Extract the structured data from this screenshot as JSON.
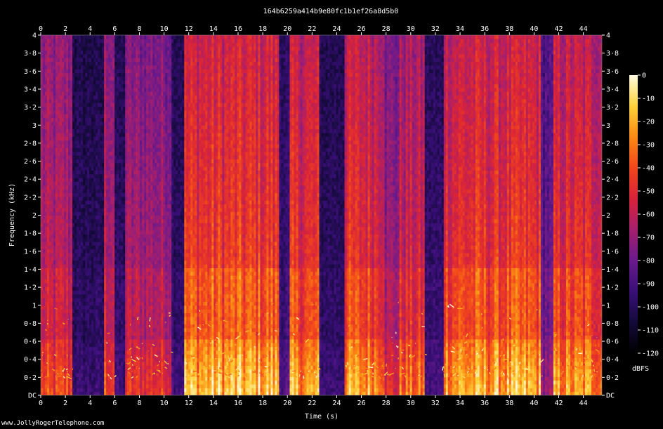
{
  "chart_data": {
    "type": "heatmap",
    "title": "164b6259a414b9e80fc1b1ef26a8d5b0",
    "xlabel": "Time (s)",
    "ylabel": "Frequency (kHz)",
    "xlim": [
      0,
      45.5
    ],
    "ylim": [
      0,
      4
    ],
    "x_ticks": [
      "0",
      "2",
      "4",
      "6",
      "8",
      "10",
      "12",
      "14",
      "16",
      "18",
      "20",
      "22",
      "24",
      "26",
      "28",
      "30",
      "32",
      "34",
      "36",
      "38",
      "40",
      "42",
      "44"
    ],
    "y_ticks": [
      "DC",
      "0·2",
      "0·4",
      "0·6",
      "0·8",
      "1",
      "1·2",
      "1·4",
      "1·6",
      "1·8",
      "2",
      "2·2",
      "2·4",
      "2·6",
      "2·8",
      "3",
      "3·2",
      "3·4",
      "3·6",
      "3·8",
      "4"
    ],
    "colorbar": {
      "label": "dBFS",
      "range": [
        -120,
        0
      ],
      "ticks": [
        "0",
        "-10",
        "-20",
        "-30",
        "-40",
        "-50",
        "-60",
        "-70",
        "-80",
        "-90",
        "-100",
        "-110",
        "-120"
      ],
      "colormap": [
        "#000000",
        "#140a3a",
        "#3a0f78",
        "#6a1a8c",
        "#a51f6e",
        "#d8233a",
        "#f2461c",
        "#fb8a14",
        "#fdd23a",
        "#fffbe0"
      ]
    },
    "activity_by_time": [
      {
        "t_start": 0.0,
        "t_end": 2.6,
        "level": 0.62
      },
      {
        "t_start": 2.6,
        "t_end": 5.2,
        "level": 0.18
      },
      {
        "t_start": 5.2,
        "t_end": 6.0,
        "level": 0.65
      },
      {
        "t_start": 6.0,
        "t_end": 6.9,
        "level": 0.2
      },
      {
        "t_start": 6.9,
        "t_end": 10.6,
        "level": 0.58
      },
      {
        "t_start": 10.6,
        "t_end": 11.7,
        "level": 0.22
      },
      {
        "t_start": 11.7,
        "t_end": 19.3,
        "level": 0.85
      },
      {
        "t_start": 19.3,
        "t_end": 20.2,
        "level": 0.25
      },
      {
        "t_start": 20.2,
        "t_end": 22.6,
        "level": 0.8
      },
      {
        "t_start": 22.6,
        "t_end": 24.6,
        "level": 0.2
      },
      {
        "t_start": 24.6,
        "t_end": 27.8,
        "level": 0.8
      },
      {
        "t_start": 27.8,
        "t_end": 29.0,
        "level": 0.55
      },
      {
        "t_start": 29.0,
        "t_end": 31.2,
        "level": 0.7
      },
      {
        "t_start": 31.2,
        "t_end": 32.6,
        "level": 0.22
      },
      {
        "t_start": 32.6,
        "t_end": 40.6,
        "level": 0.82
      },
      {
        "t_start": 40.6,
        "t_end": 41.5,
        "level": 0.4
      },
      {
        "t_start": 41.5,
        "t_end": 45.5,
        "level": 0.78
      }
    ],
    "grid": false
  },
  "watermark": "www.JollyRogerTelephone.com"
}
